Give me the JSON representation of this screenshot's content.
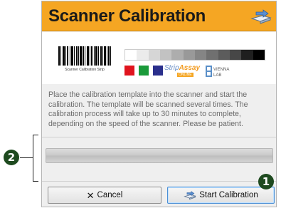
{
  "dialog": {
    "title": "Scanner Calibration",
    "title_icon": "scanner-arrow-icon",
    "accent_color": "#f5a623"
  },
  "strip": {
    "barcode_label": "Scanner Calibration Strip",
    "grayscale_colors": [
      "#ffffff",
      "#ebebeb",
      "#d6d6d6",
      "#c2c2c2",
      "#adadad",
      "#999999",
      "#858585",
      "#707070",
      "#5c5c5c",
      "#474747",
      "#1f1f1f",
      "#000000"
    ],
    "swatch_colors": [
      "#e0141e",
      "#1a9a3a",
      "#2a2f8c"
    ],
    "logo_stripassay": "Strip",
    "logo_stripassay_b": "Assay",
    "logo_stripassay_sub": "ONLINE",
    "logo_vienna": "VIENNA LAB"
  },
  "instructions": "Place the calibration template into the scanner and start the calibration. The template will be scanned several times. The calibration process will take up to 30 minutes to complete, depending on the speed of the scanner. Please be patient.",
  "progress": {
    "value": 0
  },
  "buttons": {
    "cancel_label": "Cancel",
    "cancel_icon": "close-x-icon",
    "start_label": "Start Calibration",
    "start_icon": "scanner-arrow-icon"
  },
  "callouts": {
    "one": "1",
    "two": "2"
  }
}
